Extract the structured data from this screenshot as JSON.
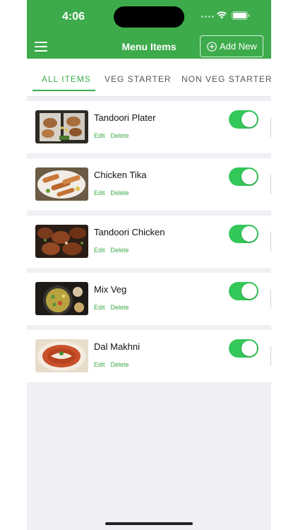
{
  "status_bar": {
    "time": "4:06"
  },
  "header": {
    "title": "Menu Items",
    "add_button_label": "Add New"
  },
  "tabs": [
    {
      "label": "ALL ITEMS",
      "active": true
    },
    {
      "label": "VEG STARTER",
      "active": false
    },
    {
      "label": "NON VEG STARTER",
      "active": false
    }
  ],
  "items": [
    {
      "name": "Tandoori Plater",
      "edit_label": "Edit",
      "delete_label": "Delete",
      "enabled": true
    },
    {
      "name": "Chicken Tika",
      "edit_label": "Edit",
      "delete_label": "Delete",
      "enabled": true
    },
    {
      "name": "Tandoori Chicken",
      "edit_label": "Edit",
      "delete_label": "Delete",
      "enabled": true
    },
    {
      "name": "Mix Veg",
      "edit_label": "Edit",
      "delete_label": "Delete",
      "enabled": true
    },
    {
      "name": "Dal Makhni",
      "edit_label": "Edit",
      "delete_label": "Delete",
      "enabled": true
    }
  ],
  "colors": {
    "brand": "#3dab4b",
    "toggle_on": "#34c759",
    "background": "#efeff4"
  }
}
